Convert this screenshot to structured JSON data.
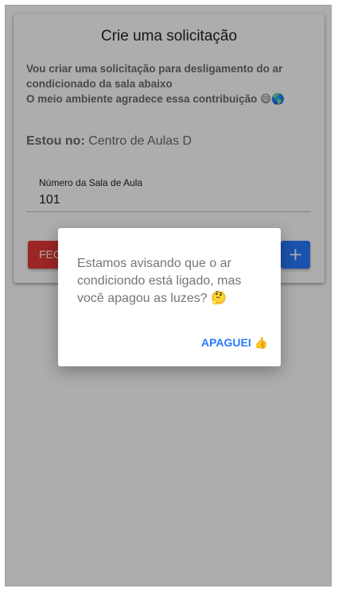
{
  "form": {
    "title": "Crie uma solicitação",
    "subtitle_lines": [
      "Vou criar uma solicitação para desligamento do ar",
      "condicionado da sala abaixo",
      "O meio ambiente agradece essa contribuição 😄🌎"
    ],
    "location_label": "Estou no:",
    "location_value": "Centro de Aulas D",
    "room_field": {
      "label": "Número da Sala de Aula",
      "value": "101"
    },
    "close_button_label": "FECHAR",
    "add_button_icon": "plus-icon"
  },
  "dialog": {
    "message": "Estamos avisando que o ar condiciondo está ligado, mas você apagou as luzes? 🤔",
    "action_label": "APAGUEI 👍"
  },
  "colors": {
    "close_button": "#e53935",
    "add_button": "#2979ff",
    "dialog_action": "#2979ff"
  }
}
